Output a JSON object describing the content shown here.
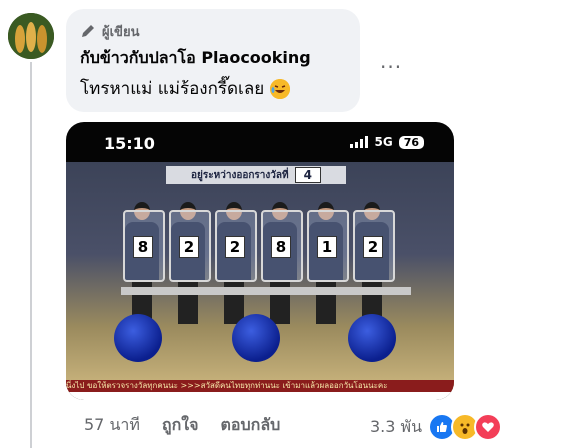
{
  "comment": {
    "badge_label": "ผู้เขียน",
    "author": "กับข้าวกับปลาโอ Plaocooking",
    "text": "โทรหาแม่ แม่ร้องกรี๊ดเลย",
    "more_label": "···"
  },
  "media": {
    "status_time": "15:10",
    "network": "5G",
    "battery": "76",
    "banner_text": "อยู่ระหว่างออกรางวัลที่",
    "banner_number": "4",
    "digits": [
      "8",
      "2",
      "2",
      "8",
      "1",
      "2"
    ],
    "ticker_text": "นี่งไป ขอให้ตรวจรางวัลทุกคนนะ  >>>สวัสดีคนไทยทุกท่านนะ เข้ามาแล้วผลออกวันโอนนะคะ"
  },
  "footer": {
    "timestamp": "57 นาที",
    "like_label": "ถูกใจ",
    "reply_label": "ตอบกลับ",
    "reaction_count": "3.3 พัน"
  },
  "colors": {
    "bubble_bg": "#f0f2f5",
    "like_blue": "#1877f2",
    "love_red": "#f33e58",
    "wow_yellow": "#f7b928"
  },
  "icons": {
    "badge": "pencil-icon",
    "reactions": [
      "like-icon",
      "wow-icon",
      "love-icon"
    ]
  }
}
